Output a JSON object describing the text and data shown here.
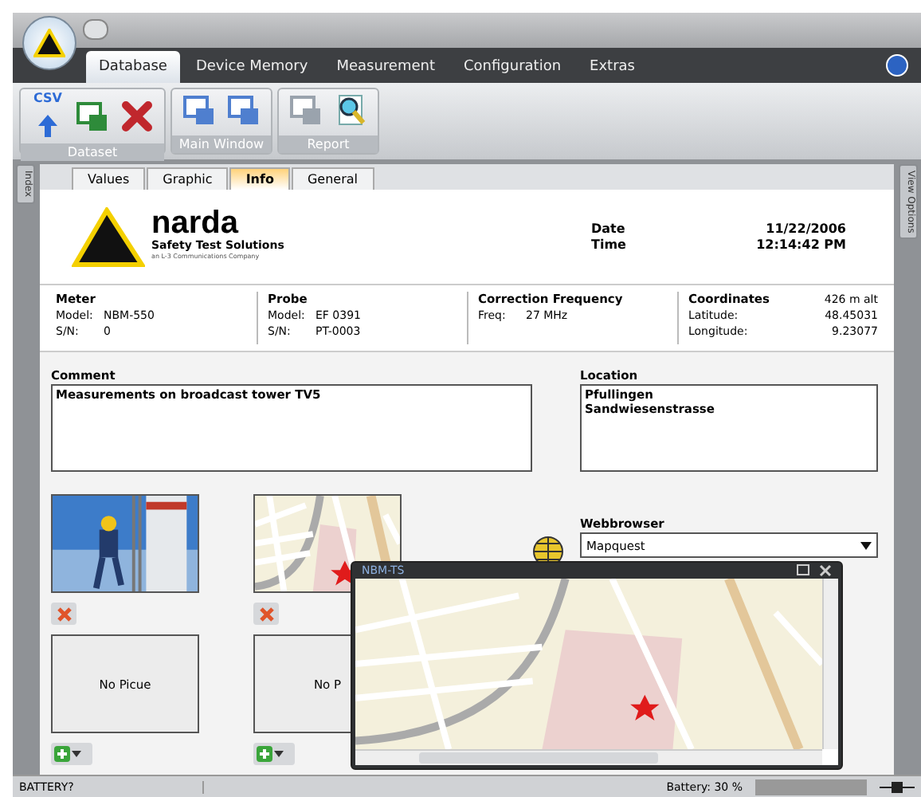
{
  "ribbon": {
    "tabs": [
      {
        "label": "Database",
        "selected": true
      },
      {
        "label": "Device Memory",
        "selected": false
      },
      {
        "label": "Measurement",
        "selected": false
      },
      {
        "label": "Configuration",
        "selected": false
      },
      {
        "label": "Extras",
        "selected": false
      }
    ],
    "groups": [
      {
        "label": "Dataset",
        "tools": [
          {
            "kind": "csv"
          },
          {
            "kind": "excel"
          },
          {
            "kind": "delete"
          }
        ]
      },
      {
        "label": "Main Window",
        "tools": [
          {
            "kind": "clip"
          },
          {
            "kind": "print"
          }
        ]
      },
      {
        "label": "Report",
        "tools": [
          {
            "kind": "print2"
          },
          {
            "kind": "preview"
          }
        ]
      }
    ],
    "csv_label": "CSV"
  },
  "side_tabs": {
    "left": "Index",
    "right": "View Options"
  },
  "view_tabs": [
    {
      "label": "Values",
      "selected": false
    },
    {
      "label": "Graphic",
      "selected": false
    },
    {
      "label": "Info",
      "selected": true
    },
    {
      "label": "General",
      "selected": false
    }
  ],
  "logo": {
    "name": "narda",
    "tagline": "Safety Test Solutions",
    "sub": "an L-3 Communications Company"
  },
  "stamp": [
    {
      "label": "Date",
      "value": "11/22/2006"
    },
    {
      "label": "Time",
      "value": "12:14:42 PM"
    }
  ],
  "sections": [
    {
      "title": "Meter",
      "rows": [
        [
          "Model:",
          "NBM-550"
        ],
        [
          "S/N:",
          "0"
        ]
      ]
    },
    {
      "title": "Probe",
      "rows": [
        [
          "Model:",
          "EF 0391"
        ],
        [
          "S/N:",
          "PT-0003"
        ]
      ]
    },
    {
      "title": "Correction Frequency",
      "rows": [
        [
          "Freq:",
          "27 MHz"
        ]
      ]
    },
    {
      "title": "Coordinates",
      "extra": "426 m alt",
      "rows": [
        [
          "Latitude:",
          "48.45031"
        ],
        [
          "Longitude:",
          "9.23077"
        ]
      ]
    }
  ],
  "comment": {
    "label": "Comment",
    "value": "Measurements on broadcast tower TV5"
  },
  "location": {
    "label": "Location",
    "value": "Pfullingen\nSandwiesenstrasse"
  },
  "pictures": [
    {
      "empty_text": "No Picue"
    },
    {
      "kind": "map",
      "empty_text": "No P"
    }
  ],
  "webbrowser": {
    "label": "Webbrowser",
    "value": "Mapquest"
  },
  "popup": {
    "title": "NBM-TS"
  },
  "status": {
    "left": "BATTERY?",
    "battery": "Battery: 30 %"
  }
}
